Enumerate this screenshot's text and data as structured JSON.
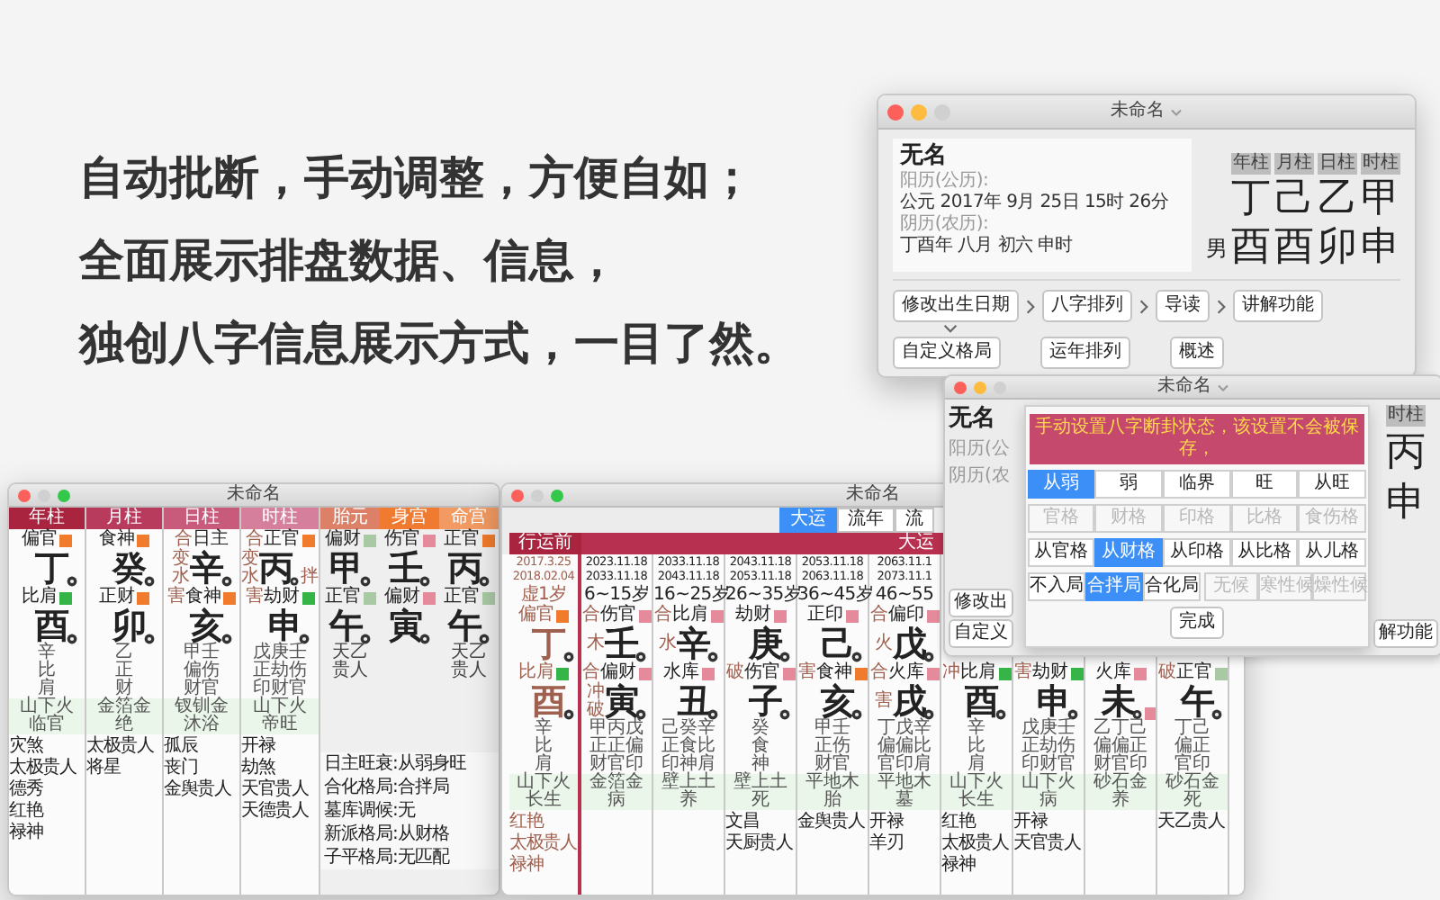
{
  "headline": [
    "自动批断，手动调整，方便自如；",
    "全面展示排盘数据、信息，",
    "独创八字信息展示方式，一目了然。"
  ],
  "main_window": {
    "title": "未命名",
    "title_menu": true,
    "minimize_disabled": false,
    "zoom_disabled": true,
    "name": "无名",
    "solar_label": "阳历(公历):",
    "solar": "公元 2017年 9月 25日 15时 26分",
    "lunar_label": "阴历(农历):",
    "lunar": "丁酉年 八月 初六 申时",
    "gender": "男",
    "pillars": [
      {
        "label": "年柱",
        "stem": "丁",
        "branch": "酉"
      },
      {
        "label": "月柱",
        "stem": "己",
        "branch": "酉"
      },
      {
        "label": "日柱",
        "stem": "乙",
        "branch": "卯"
      },
      {
        "label": "时柱",
        "stem": "甲",
        "branch": "申"
      }
    ],
    "steps": [
      "修改出生日期",
      "八字排列",
      "导读",
      "讲解功能"
    ],
    "extra_buttons": [
      "自定义格局",
      "运年排列",
      "概述"
    ]
  },
  "chart_window": {
    "title": "未命名",
    "minimize_disabled": true,
    "zoom_disabled": false,
    "columns": [
      {
        "kind": "pillar",
        "label": "年柱",
        "color": "#a8243f",
        "top": {
          "god": "偏官",
          "color": "#f07b2c"
        },
        "stem": "丁",
        "bottom": {
          "god": "比肩",
          "color": "#35b548"
        },
        "branch": "酉",
        "hidden": [
          "辛",
          "比",
          "肩"
        ],
        "nayin": "山下火",
        "stage": "临官",
        "shensha": [
          "灾煞",
          "太极贵人",
          "德秀",
          "红艳",
          "禄神"
        ]
      },
      {
        "kind": "pillar",
        "label": "月柱",
        "color": "#b83a5c",
        "top": {
          "god": "食神",
          "color": "#f07b2c"
        },
        "stem": "癸",
        "bottom": {
          "god": "正财",
          "color": "#f07b2c"
        },
        "branch": "卯",
        "hidden": [
          "乙",
          "正",
          "财"
        ],
        "nayin": "金箔金",
        "stage": "绝",
        "shensha": [
          "太极贵人",
          "将星"
        ]
      },
      {
        "kind": "pillar",
        "label": "日柱",
        "color": "#c85a7c",
        "top": {
          "prefix": "合",
          "god": "日主"
        },
        "top_side": [
          "变",
          "水"
        ],
        "stem": "辛",
        "bottom": {
          "prefix": "害",
          "god": "食神",
          "color": "#f07b2c"
        },
        "branch": "亥",
        "hidden": [
          "甲壬",
          "偏伤",
          "财官"
        ],
        "nayin": "钗钏金",
        "stage": "沐浴",
        "shensha": [
          "孤辰",
          "丧门",
          "金舆贵人"
        ]
      },
      {
        "kind": "pillar",
        "label": "时柱",
        "color": "#d67f9c",
        "top": {
          "prefix": "合",
          "god": "正官",
          "color": "#f07b2c"
        },
        "top_side": [
          "变",
          "水"
        ],
        "stem": "丙",
        "stem_note": "拌",
        "bottom": {
          "prefix": "害",
          "god": "劫财",
          "color": "#35b548"
        },
        "branch": "申",
        "hidden": [
          "戊庚壬",
          "正劫伤",
          "印财官"
        ],
        "nayin": "山下火",
        "stage": "帝旺",
        "shensha": [
          "开禄",
          "劫煞",
          "天官贵人",
          "天德贵人"
        ]
      },
      {
        "kind": "palace",
        "label": "胎元",
        "color": "#dc8068",
        "top": {
          "god": "偏财",
          "color": "#a9c9a4"
        },
        "stem": "甲",
        "bottom": {
          "god": "正官",
          "color": "#a9c9a4"
        },
        "branch": "午",
        "shensha": [
          "天乙贵人"
        ]
      },
      {
        "kind": "palace",
        "label": "身宫",
        "color": "#f07a30",
        "top": {
          "god": "伤官",
          "color": "#e58a9a"
        },
        "stem": "壬",
        "bottom": {
          "god": "偏财",
          "color": "#e58a9a"
        },
        "branch": "寅"
      },
      {
        "kind": "palace",
        "label": "命宫",
        "color": "#f29a62",
        "top": {
          "god": "正官",
          "color": "#f07b2c"
        },
        "stem": "丙",
        "bottom": {
          "god": "正官",
          "color": "#a9c9a4"
        },
        "branch": "午",
        "shensha": [
          "天乙贵人"
        ]
      }
    ],
    "info": [
      {
        "label": "日主旺衰:",
        "value": "从弱身旺"
      },
      {
        "label": "合化格局:",
        "value": "合拌局"
      },
      {
        "label": "墓库调候:",
        "value": "无"
      },
      {
        "label": "新派格局:",
        "value": "从财格"
      },
      {
        "label": "子平格局:",
        "value": "无匹配"
      }
    ]
  },
  "luck_window": {
    "title": "未命名",
    "minimize_disabled": true,
    "zoom_disabled": false,
    "tabs": [
      {
        "label": "大运",
        "selected": true
      },
      {
        "label": "流年",
        "selected": false
      },
      {
        "label": "流",
        "selected": false
      }
    ],
    "pre_label": "行运前",
    "luck_label": "大运",
    "columns": [
      {
        "kind": "pre",
        "dates": [
          "2017.3.25",
          "2018.02.04"
        ],
        "age": "虚1岁",
        "top": {
          "god": "偏官",
          "color": "#f07b2c"
        },
        "stem": "丁",
        "bottom": {
          "god": "比肩",
          "color": "#35b548"
        },
        "branch": "酉",
        "hidden": [
          "辛",
          "比",
          "肩"
        ],
        "nayin": "山下火",
        "stage": "长生",
        "shensha": [
          "红艳",
          "太极贵人",
          "禄神"
        ]
      },
      {
        "kind": "luck",
        "dates": [
          "2023.11.18",
          "2033.11.18"
        ],
        "age": "6~15岁",
        "top": {
          "prefix": "合",
          "god": "伤官",
          "color": "#e58a9a"
        },
        "top_side": [
          "木"
        ],
        "stem": "壬",
        "bottom": {
          "prefix": "合",
          "god": "偏财",
          "color": "#e58a9a"
        },
        "bottom_side": [
          "冲",
          "破"
        ],
        "branch": "寅",
        "hidden": [
          "甲丙戊",
          "正正偏",
          "财官印"
        ],
        "nayin": "金箔金",
        "stage": "病"
      },
      {
        "kind": "luck",
        "dates": [
          "2033.11.18",
          "2043.11.18"
        ],
        "age": "16~25岁",
        "top": {
          "prefix": "合",
          "god": "比肩",
          "color": "#e58a9a"
        },
        "top_side": [
          "水"
        ],
        "stem": "辛",
        "bottom": {
          "god": "水库",
          "color": "#e58a9a"
        },
        "branch": "丑",
        "hidden": [
          "己癸辛",
          "正食比",
          "印神肩"
        ],
        "nayin": "壁上土",
        "stage": "养"
      },
      {
        "kind": "luck",
        "dates": [
          "2043.11.18",
          "2053.11.18"
        ],
        "age": "26~35岁",
        "top": {
          "god": "劫财",
          "color": "#e58a9a"
        },
        "stem": "庚",
        "bottom": {
          "prefix": "破",
          "god": "伤官",
          "color": "#e58a9a"
        },
        "branch": "子",
        "hidden": [
          "癸",
          "食",
          "神"
        ],
        "nayin": "壁上土",
        "stage": "死",
        "shensha": [
          "文昌",
          "天厨贵人"
        ]
      },
      {
        "kind": "luck",
        "dates": [
          "2053.11.18",
          "2063.11.18"
        ],
        "age": "36~45岁",
        "top": {
          "god": "正印",
          "color": "#e58a9a"
        },
        "stem": "己",
        "bottom": {
          "prefix": "害",
          "god": "食神",
          "color": "#f07b2c"
        },
        "branch": "亥",
        "hidden": [
          "甲壬",
          "正伤",
          "财官"
        ],
        "nayin": "平地木",
        "stage": "胎",
        "shensha": [
          "金舆贵人"
        ]
      },
      {
        "kind": "luck",
        "dates": [
          "2063.11.1",
          "2073.11.1"
        ],
        "age": "46~55",
        "top": {
          "prefix": "合",
          "god": "偏印",
          "color": "#e58a9a"
        },
        "top_side": [
          "火"
        ],
        "stem": "戊",
        "bottom": {
          "prefix": "合",
          "god": "火库",
          "color": "#e58a9a"
        },
        "bottom_side": [
          "害"
        ],
        "branch": "戌",
        "hidden": [
          "丁戊辛",
          "偏偏比",
          "官印肩"
        ],
        "nayin": "平地木",
        "stage": "墓",
        "shensha": [
          "开禄",
          "羊刃"
        ]
      },
      {
        "kind": "luck",
        "bottom": {
          "prefix": "冲",
          "god": "比肩",
          "color": "#35b548"
        },
        "branch": "酉",
        "hidden": [
          "辛",
          "比",
          "肩"
        ],
        "nayin": "山下火",
        "stage": "长生",
        "shensha": [
          "红艳",
          "太极贵人",
          "禄神"
        ]
      },
      {
        "kind": "luck",
        "bottom": {
          "prefix": "害",
          "god": "劫财",
          "color": "#35b548"
        },
        "branch": "申",
        "hidden": [
          "戊庚壬",
          "正劫伤",
          "印财官"
        ],
        "nayin": "山下火",
        "stage": "病",
        "shensha": [
          "开禄",
          "天官贵人"
        ]
      },
      {
        "kind": "luck",
        "bottom": {
          "god": "火库",
          "color": "#e58a9a"
        },
        "branch": "未",
        "branch_badge": {
          "color": "#e58a9a"
        },
        "hidden": [
          "乙丁己",
          "偏偏正",
          "财官印"
        ],
        "nayin": "砂石金",
        "stage": "养"
      },
      {
        "kind": "luck",
        "bottom": {
          "prefix": "破",
          "god": "正官",
          "color": "#a9c9a4"
        },
        "branch": "午",
        "hidden": [
          "丁己",
          "偏正",
          "官印"
        ],
        "nayin": "砂石金",
        "stage": "死",
        "shensha": [
          "天乙贵人"
        ]
      }
    ]
  },
  "dialog_window": {
    "title": "未命名",
    "title_menu": true,
    "minimize_disabled": false,
    "zoom_disabled": true,
    "name": "无名",
    "solar_label": "阳历(公",
    "lunar_label": "阴历(农",
    "left_buttons": [
      "修改出",
      "自定义"
    ],
    "pillar_label": "时柱",
    "stem": "丙",
    "branch": "申",
    "right_button": "解功能",
    "sheet": {
      "banner": "手动设置八字断卦状态，该设置不会被保存，",
      "done": "完成",
      "rows": [
        {
          "groups": [
            [
              {
                "label": "从弱",
                "selected": true,
                "disabled": false
              },
              {
                "label": "弱",
                "selected": false,
                "disabled": false
              },
              {
                "label": "临界",
                "selected": false,
                "disabled": false
              },
              {
                "label": "旺",
                "selected": false,
                "disabled": false
              },
              {
                "label": "从旺",
                "selected": false,
                "disabled": false
              }
            ]
          ]
        },
        {
          "groups": [
            [
              {
                "label": "官格",
                "selected": false,
                "disabled": true
              },
              {
                "label": "财格",
                "selected": false,
                "disabled": true
              },
              {
                "label": "印格",
                "selected": false,
                "disabled": true
              },
              {
                "label": "比格",
                "selected": false,
                "disabled": true
              },
              {
                "label": "食伤格",
                "selected": false,
                "disabled": true
              }
            ]
          ]
        },
        {
          "groups": [
            [
              {
                "label": "从官格",
                "selected": false,
                "disabled": false
              },
              {
                "label": "从财格",
                "selected": true,
                "disabled": false
              },
              {
                "label": "从印格",
                "selected": false,
                "disabled": false
              },
              {
                "label": "从比格",
                "selected": false,
                "disabled": false
              },
              {
                "label": "从儿格",
                "selected": false,
                "disabled": false
              }
            ]
          ]
        },
        {
          "groups": [
            [
              {
                "label": "不入局",
                "selected": false,
                "disabled": false
              },
              {
                "label": "合拌局",
                "selected": true,
                "disabled": false
              },
              {
                "label": "合化局",
                "selected": false,
                "disabled": false
              }
            ],
            [
              {
                "label": "无候",
                "selected": false,
                "disabled": true
              },
              {
                "label": "寒性候",
                "selected": false,
                "disabled": true
              },
              {
                "label": "燥性候",
                "selected": false,
                "disabled": true
              }
            ]
          ]
        }
      ]
    }
  }
}
